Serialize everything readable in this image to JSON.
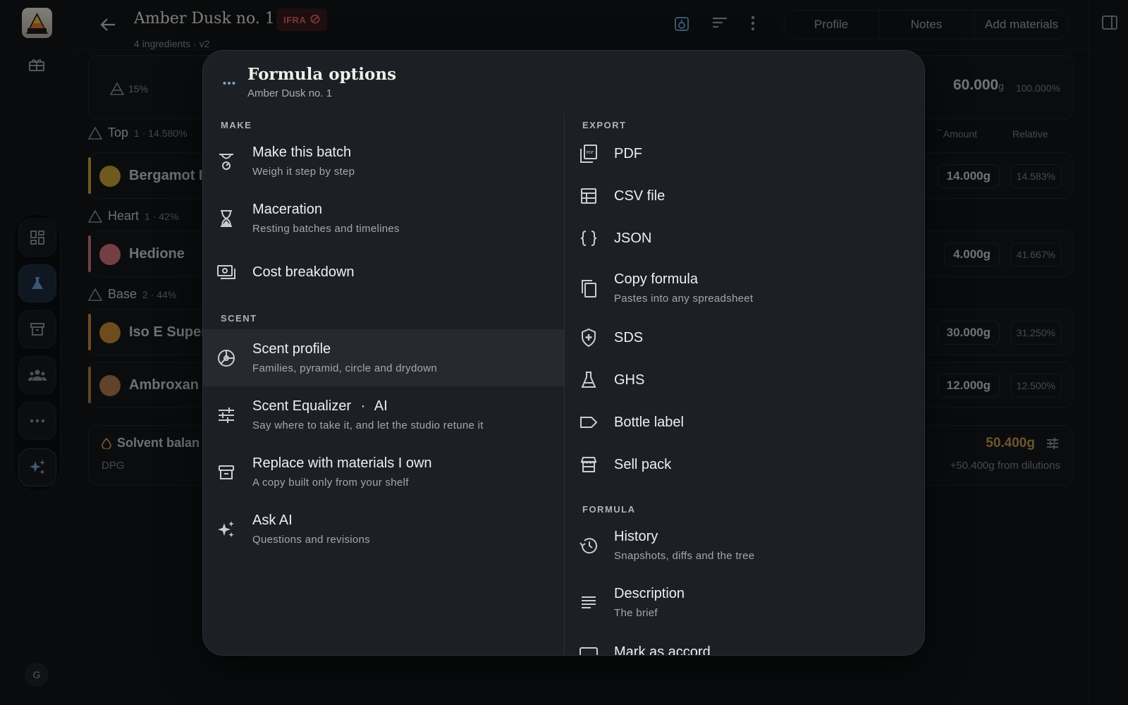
{
  "header": {
    "title": "Amber Dusk no. 1",
    "badge": "IFRA",
    "subtitle": "4 ingredients · v2",
    "tabs": [
      "Profile",
      "Notes",
      "Add materials"
    ]
  },
  "summary": {
    "concentration": "15%",
    "total": "60.000",
    "total_unit": "g",
    "total_pct": "100.000%"
  },
  "columns": {
    "amount": "Amount",
    "relative": "Relative"
  },
  "sections": {
    "top": {
      "label": "Top",
      "meta": "1 · 14.580%"
    },
    "heart": {
      "label": "Heart",
      "meta": "1 · 42%"
    },
    "base": {
      "label": "Base",
      "meta": "2 · 44%"
    }
  },
  "ingredients": [
    {
      "name": "Bergamot I",
      "amount": "14.000g",
      "relative": "14.583%",
      "color": "#c9a23a"
    },
    {
      "name": "Hedione",
      "amount": "4.000g",
      "relative": "41.667%",
      "color": "#d4737a"
    },
    {
      "name": "Iso E Super",
      "amount": "30.000g",
      "relative": "31.250%",
      "color": "#c98a3a"
    },
    {
      "name": "Ambroxan",
      "amount": "12.000g",
      "relative": "12.500%",
      "color": "#b07a4a"
    }
  ],
  "solvent": {
    "label": "Solvent balan",
    "sub": "DPG",
    "value": "50.400g",
    "note": "+50.400g from dilutions"
  },
  "rail": {
    "avatar": "G"
  },
  "modal": {
    "title": "Formula options",
    "subtitle": "Amber Dusk no. 1",
    "make": {
      "heading": "MAKE",
      "items": [
        {
          "label": "Make this batch",
          "desc": "Weigh it step by step",
          "icon": "scale-icon"
        },
        {
          "label": "Maceration",
          "desc": "Resting batches and timelines",
          "icon": "hourglass-icon"
        },
        {
          "label": "Cost breakdown",
          "desc": "",
          "icon": "cash-icon"
        }
      ]
    },
    "scent": {
      "heading": "SCENT",
      "items": [
        {
          "label": "Scent profile",
          "desc": "Families, pyramid, circle and drydown",
          "icon": "scent-wheel-icon"
        },
        {
          "label": "Scent Equalizer",
          "tag": "AI",
          "desc": "Say where to take it, and let the studio retune it",
          "icon": "equalizer-icon"
        },
        {
          "label": "Replace with materials I own",
          "desc": "A copy built only from your shelf",
          "icon": "archive-icon"
        },
        {
          "label": "Ask AI",
          "desc": "Questions and revisions",
          "icon": "sparkle-icon"
        }
      ]
    },
    "export": {
      "heading": "EXPORT",
      "items": [
        {
          "label": "PDF",
          "desc": "",
          "icon": "pdf-icon"
        },
        {
          "label": "CSV file",
          "desc": "",
          "icon": "table-icon"
        },
        {
          "label": "JSON",
          "desc": "",
          "icon": "braces-icon"
        },
        {
          "label": "Copy formula",
          "desc": "Pastes into any spreadsheet",
          "icon": "copy-icon"
        },
        {
          "label": "SDS",
          "desc": "",
          "icon": "shield-icon"
        },
        {
          "label": "GHS",
          "desc": "",
          "icon": "flask-icon"
        },
        {
          "label": "Bottle label",
          "desc": "",
          "icon": "label-icon"
        },
        {
          "label": "Sell pack",
          "desc": "",
          "icon": "store-icon"
        }
      ]
    },
    "formula": {
      "heading": "FORMULA",
      "items": [
        {
          "label": "History",
          "desc": "Snapshots, diffs and the tree",
          "icon": "history-icon"
        },
        {
          "label": "Description",
          "desc": "The brief",
          "icon": "lines-icon"
        },
        {
          "label": "Mark as accord",
          "desc": "",
          "icon": "accord-icon"
        }
      ]
    }
  }
}
